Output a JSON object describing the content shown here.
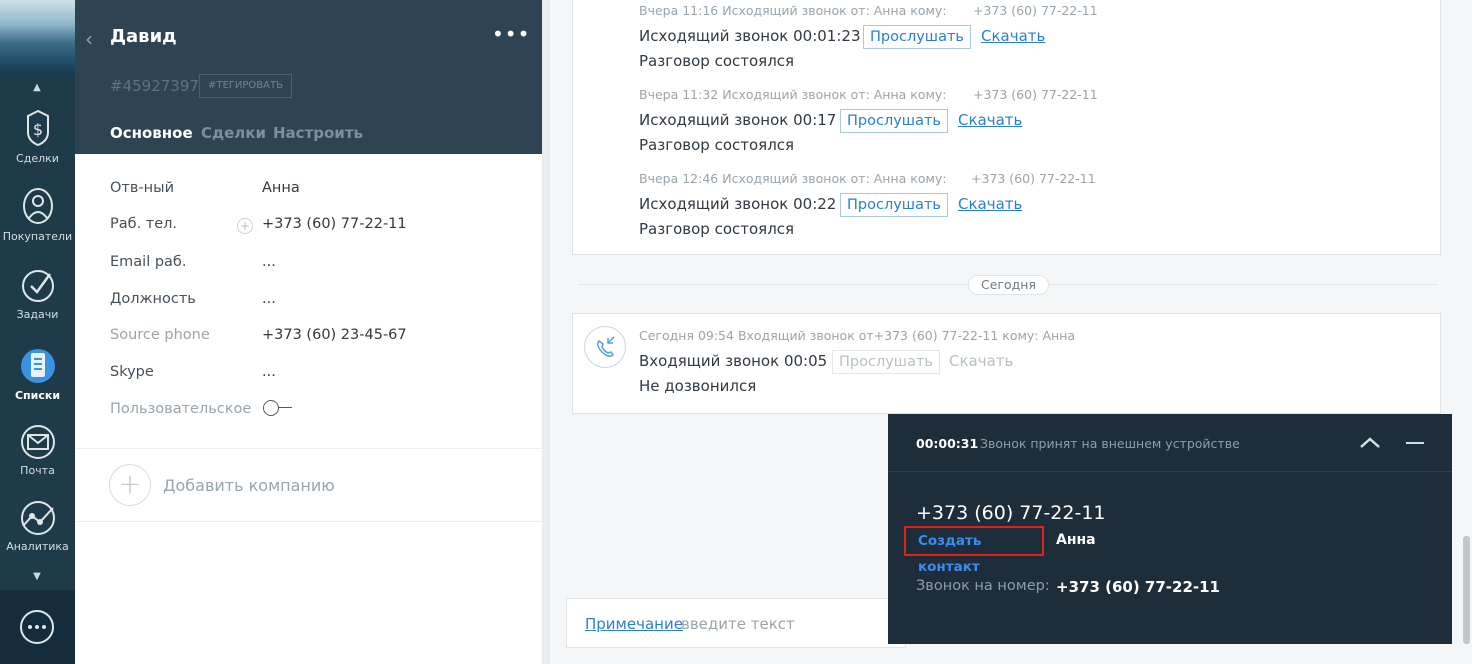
{
  "nav": {
    "items": [
      {
        "label": "Сделки",
        "icon": "dollar-icon"
      },
      {
        "label": "Покупатели",
        "icon": "people-icon"
      },
      {
        "label": "Задачи",
        "icon": "checkmark-icon"
      },
      {
        "label": "Списки",
        "icon": "list-icon"
      },
      {
        "label": "Почта",
        "icon": "mail-icon"
      },
      {
        "label": "Аналитика",
        "icon": "analytics-icon"
      }
    ],
    "active": "Списки"
  },
  "card": {
    "title": "Давид",
    "id": "#45927397",
    "tag_label": "#ТЕГИРОВАТЬ",
    "tabs": [
      "Основное",
      "Сделки",
      "Настроить"
    ],
    "fields": [
      {
        "label": "Отв-ный",
        "value": "Анна"
      },
      {
        "label": "Раб. тел.",
        "value": "+373 (60) 77-22-11"
      },
      {
        "label": "Email раб.",
        "value": "..."
      },
      {
        "label": "Должность",
        "value": "..."
      },
      {
        "label": "Source phone",
        "value": "+373 (60) 23-45-67"
      },
      {
        "label": "Skype",
        "value": "..."
      },
      {
        "label": "Пользовательское",
        "value": ""
      }
    ],
    "add_company": "Добавить компанию"
  },
  "feed": {
    "yesterday_calls": [
      {
        "meta": "Вчера 11:16 Исходящий звонок от: Анна кому:",
        "phone": "+373 (60) 77-22-11",
        "title": "Исходящий звонок 00:01:23",
        "listen": "Прослушать",
        "download": "Скачать",
        "result": "Разговор состоялся"
      },
      {
        "meta": "Вчера 11:32 Исходящий звонок от: Анна кому:",
        "phone": "+373 (60) 77-22-11",
        "title": "Исходящий звонок 00:17",
        "listen": "Прослушать",
        "download": "Скачать",
        "result": "Разговор состоялся"
      },
      {
        "meta": "Вчера 12:46 Исходящий звонок от: Анна кому:",
        "phone": "+373 (60) 77-22-11",
        "title": "Исходящий звонок 00:22",
        "listen": "Прослушать",
        "download": "Скачать",
        "result": "Разговор состоялся"
      }
    ],
    "today_label": "Сегодня",
    "today_call": {
      "meta": "Сегодня 09:54 Входящий звонок от+373 (60) 77-22-11 кому: Анна",
      "title": "Входящий звонок 00:05",
      "listen": "Прослушать",
      "download": "Скачать",
      "result": "Не дозвонился"
    },
    "note_link": "Примечание",
    "note_colon": ":",
    "note_placeholder": "введите текст"
  },
  "popup": {
    "timer": "00:00:31",
    "status": "Звонок принят на внешнем устройстве",
    "phone": "+373 (60) 77-22-11",
    "create_contact": "Создать контакт",
    "name": "Анна",
    "to_label": "Звонок на номер:",
    "to_number": "+373 (60) 77-22-11"
  },
  "colors": {
    "accent": "#2a7fd4",
    "highlight_box": "#e0211d",
    "sidebar": "#1f3a49",
    "popup": "#1d2d39"
  }
}
